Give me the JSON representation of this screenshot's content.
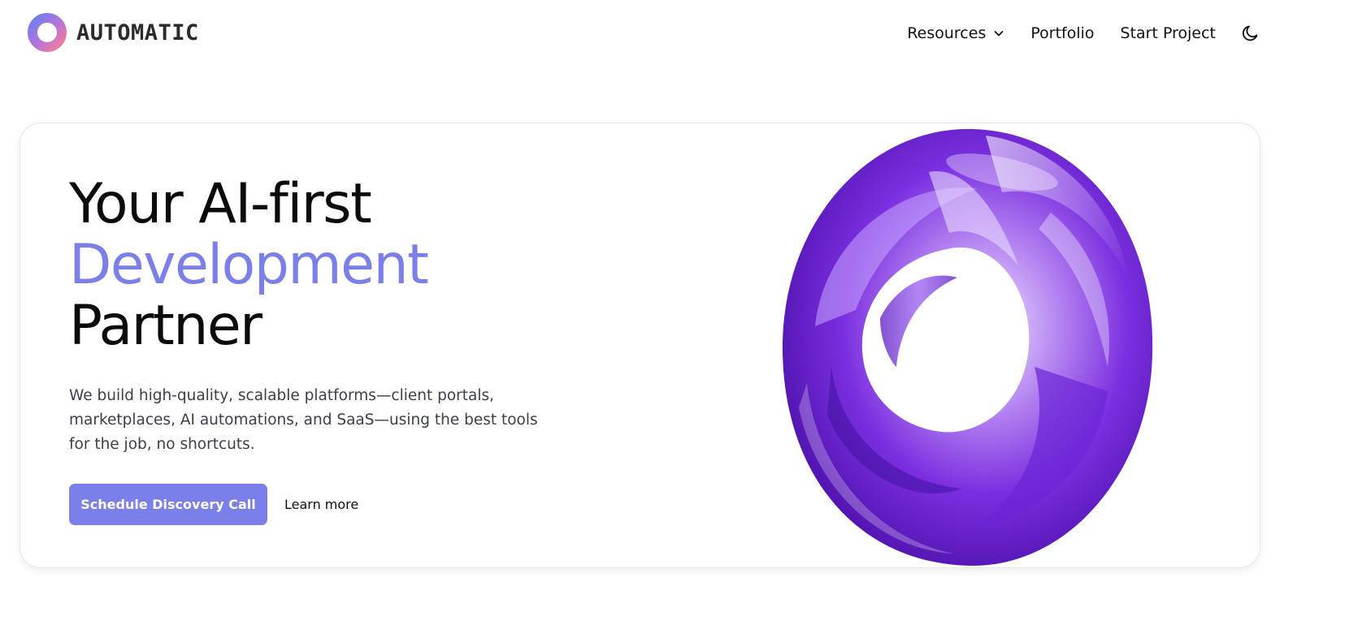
{
  "brand": {
    "name": "AUTOMATIC",
    "logo_icon": "ring-logo-icon"
  },
  "nav": {
    "items": [
      {
        "label": "Resources",
        "has_dropdown": true
      },
      {
        "label": "Portfolio"
      },
      {
        "label": "Start Project"
      }
    ],
    "theme_toggle_icon": "moon-icon"
  },
  "hero": {
    "title_line1": "Your AI-first",
    "title_line2": "Development",
    "title_line3": "Partner",
    "description": "We build high-quality, scalable platforms—client portals, marketplaces, AI automations, and SaaS—using the best tools for the job, no shortcuts.",
    "primary_cta": "Schedule Discovery Call",
    "secondary_cta": "Learn more",
    "art_icon": "purple-glass-torus-image"
  },
  "colors": {
    "accent": "#7b7fe8",
    "text": "#0b0b0b",
    "muted_text": "#3b3f4a",
    "art_purple": "#6a1fd0"
  }
}
